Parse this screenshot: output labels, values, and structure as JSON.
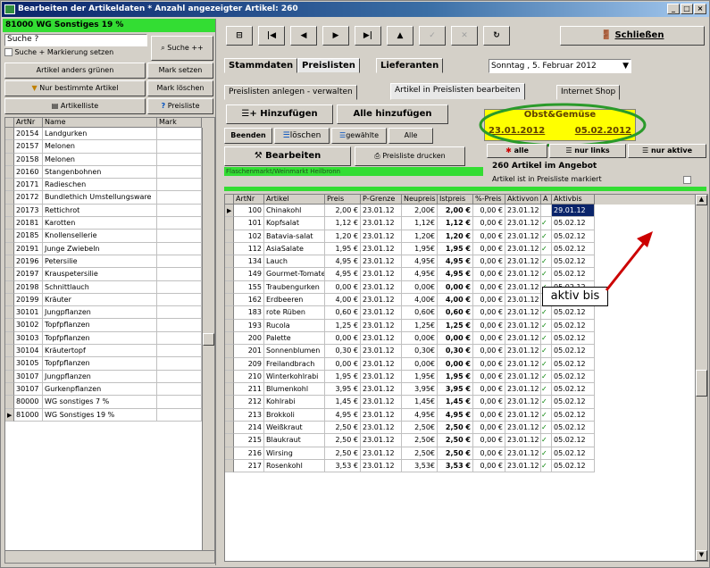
{
  "window": {
    "title": "Bearbeiten der Artikeldaten * Anzahl angezeigter Artikel: 260",
    "controls": [
      "_",
      "□",
      "×"
    ]
  },
  "left": {
    "group": "81000 WG Sonstiges 19 %",
    "search_value": "Suche ?",
    "search_btn": "Suche ++",
    "search_mark_label": "Suche + Markierung setzen",
    "btn_grun": "Artikel anders grünen",
    "btn_mark": "Mark setzen",
    "btn_filter": "Nur bestimmte Artikel",
    "btn_mark_del": "Mark löschen",
    "btn_list": "Artikelliste",
    "btn_prices": "Preisliste",
    "cols": [
      "ArtNr",
      "Name",
      "Mark"
    ],
    "rows": [
      [
        "20154",
        "Landgurken"
      ],
      [
        "20157",
        "Melonen"
      ],
      [
        "20158",
        "Melonen"
      ],
      [
        "20160",
        "Stangenbohnen"
      ],
      [
        "20171",
        "Radieschen"
      ],
      [
        "20172",
        "Bundlethich Umstellungsware"
      ],
      [
        "20173",
        "Rettichrot"
      ],
      [
        "20181",
        "Karotten"
      ],
      [
        "20185",
        "Knollensellerie"
      ],
      [
        "20191",
        "Junge Zwiebeln"
      ],
      [
        "20196",
        "Petersilie"
      ],
      [
        "20197",
        "Krauspetersilie"
      ],
      [
        "20198",
        "Schnittlauch"
      ],
      [
        "20199",
        "Kräuter"
      ],
      [
        "30101",
        "Jungpflanzen"
      ],
      [
        "30102",
        "Topfpflanzen"
      ],
      [
        "30103",
        "Topfpflanzen"
      ],
      [
        "30104",
        "Kräutertopf"
      ],
      [
        "30105",
        "Topfpflanzen"
      ],
      [
        "30107",
        "Jungpflanzen"
      ],
      [
        "30107",
        "Gurkenpflanzen"
      ],
      [
        "80000",
        "WG sonstiges 7 %"
      ],
      [
        "81000",
        "WG Sonstiges 19 %"
      ]
    ]
  },
  "toolbar": {
    "nav": [
      "⊟",
      "|◀",
      "◀",
      "▶",
      "▶|",
      "▲",
      "✓",
      "✕",
      "↻"
    ],
    "close": "Schließen"
  },
  "tabs": {
    "stammdaten": "Stammdaten",
    "preislisten": "Preislisten",
    "lieferanten": "Lieferanten",
    "date": "Sonntag , 5. Februar 2012"
  },
  "subtabs": {
    "anlegen": "Preislisten anlegen - verwalten",
    "bearbeiten": "Artikel in Preislisten bearbeiten",
    "shop": "Internet Shop"
  },
  "actions": {
    "add": "Hinzufügen",
    "add_all": "Alle hinzufügen",
    "beenden": "Beenden",
    "loeschen": "löschen",
    "gewaehlte": "gewählte",
    "alle": "Alle",
    "alle2": "alle",
    "nur_links": "nur links",
    "nur_aktive": "nur aktive",
    "bearbeiten": "Bearbeiten",
    "drucken": "Preisliste drucken"
  },
  "pricelist": {
    "name": "Obst&Gemüse",
    "from": "23.01.2012",
    "to": "05.02.2012"
  },
  "info": {
    "count": "260 Artikel im Angebot",
    "marked": "Artikel ist in Preisliste markiert",
    "pricelist_label": "Flaschenmarkt/Weinmarkt Heilbronn"
  },
  "table": {
    "cols": [
      "ArtNr",
      "Artikel",
      "Preis",
      "P-Grenze",
      "Neupreis",
      "Istpreis",
      "%-Preis",
      "Aktivvon",
      "A",
      "Aktivbis"
    ],
    "rows": [
      [
        "100",
        "Chinakohl",
        "2,00 €",
        "23.01.12",
        "2,00€",
        "2,00 €",
        "0,00 €",
        "23.01.12",
        "",
        "29.01.12"
      ],
      [
        "101",
        "Kopfsalat",
        "1,12 €",
        "23.01.12",
        "1,12€",
        "1,12 €",
        "0,00 €",
        "23.01.12",
        "✓",
        "05.02.12"
      ],
      [
        "102",
        "Batavia-salat",
        "1,20 €",
        "23.01.12",
        "1,20€",
        "1,20 €",
        "0,00 €",
        "23.01.12",
        "✓",
        "05.02.12"
      ],
      [
        "112",
        "AsiaSalate",
        "1,95 €",
        "23.01.12",
        "1,95€",
        "1,95 €",
        "0,00 €",
        "23.01.12",
        "✓",
        "05.02.12"
      ],
      [
        "134",
        "Lauch",
        "4,95 €",
        "23.01.12",
        "4,95€",
        "4,95 €",
        "0,00 €",
        "23.01.12",
        "✓",
        "05.02.12"
      ],
      [
        "149",
        "Gourmet-Tomaten",
        "4,95 €",
        "23.01.12",
        "4,95€",
        "4,95 €",
        "0,00 €",
        "23.01.12",
        "✓",
        "05.02.12"
      ],
      [
        "155",
        "Traubengurken",
        "0,00 €",
        "23.01.12",
        "0,00€",
        "0,00 €",
        "0,00 €",
        "23.01.12",
        "✓",
        "05.02.12"
      ],
      [
        "162",
        "Erdbeeren",
        "4,00 €",
        "23.01.12",
        "4,00€",
        "4,00 €",
        "0,00 €",
        "23.01.12",
        "✓",
        "05.02.12"
      ],
      [
        "183",
        "rote Rüben",
        "0,60 €",
        "23.01.12",
        "0,60€",
        "0,60 €",
        "0,00 €",
        "23.01.12",
        "✓",
        "05.02.12"
      ],
      [
        "193",
        "Rucola",
        "1,25 €",
        "23.01.12",
        "1,25€",
        "1,25 €",
        "0,00 €",
        "23.01.12",
        "✓",
        "05.02.12"
      ],
      [
        "200",
        "Palette",
        "0,00 €",
        "23.01.12",
        "0,00€",
        "0,00 €",
        "0,00 €",
        "23.01.12",
        "✓",
        "05.02.12"
      ],
      [
        "201",
        "Sonnenblumen",
        "0,30 €",
        "23.01.12",
        "0,30€",
        "0,30 €",
        "0,00 €",
        "23.01.12",
        "✓",
        "05.02.12"
      ],
      [
        "209",
        "Freilandbrach",
        "0,00 €",
        "23.01.12",
        "0,00€",
        "0,00 €",
        "0,00 €",
        "23.01.12",
        "✓",
        "05.02.12"
      ],
      [
        "210",
        "Winterkohlrabi",
        "1,95 €",
        "23.01.12",
        "1,95€",
        "1,95 €",
        "0,00 €",
        "23.01.12",
        "✓",
        "05.02.12"
      ],
      [
        "211",
        "Blumenkohl",
        "3,95 €",
        "23.01.12",
        "3,95€",
        "3,95 €",
        "0,00 €",
        "23.01.12",
        "✓",
        "05.02.12"
      ],
      [
        "212",
        "Kohlrabi",
        "1,45 €",
        "23.01.12",
        "1,45€",
        "1,45 €",
        "0,00 €",
        "23.01.12",
        "✓",
        "05.02.12"
      ],
      [
        "213",
        "Brokkoli",
        "4,95 €",
        "23.01.12",
        "4,95€",
        "4,95 €",
        "0,00 €",
        "23.01.12",
        "✓",
        "05.02.12"
      ],
      [
        "214",
        "Weißkraut",
        "2,50 €",
        "23.01.12",
        "2,50€",
        "2,50 €",
        "0,00 €",
        "23.01.12",
        "✓",
        "05.02.12"
      ],
      [
        "215",
        "Blaukraut",
        "2,50 €",
        "23.01.12",
        "2,50€",
        "2,50 €",
        "0,00 €",
        "23.01.12",
        "✓",
        "05.02.12"
      ],
      [
        "216",
        "Wirsing",
        "2,50 €",
        "23.01.12",
        "2,50€",
        "2,50 €",
        "0,00 €",
        "23.01.12",
        "✓",
        "05.02.12"
      ],
      [
        "217",
        "Rosenkohl",
        "3,53 €",
        "23.01.12",
        "3,53€",
        "3,53 €",
        "0,00 €",
        "23.01.12",
        "✓",
        "05.02.12"
      ]
    ]
  },
  "callout": "aktiv bis",
  "colors": {
    "accent_green": "#33dd33",
    "highlight_yellow": "#ffff00",
    "ellipse": "#2a9a2a",
    "arrow": "#cc0000"
  }
}
